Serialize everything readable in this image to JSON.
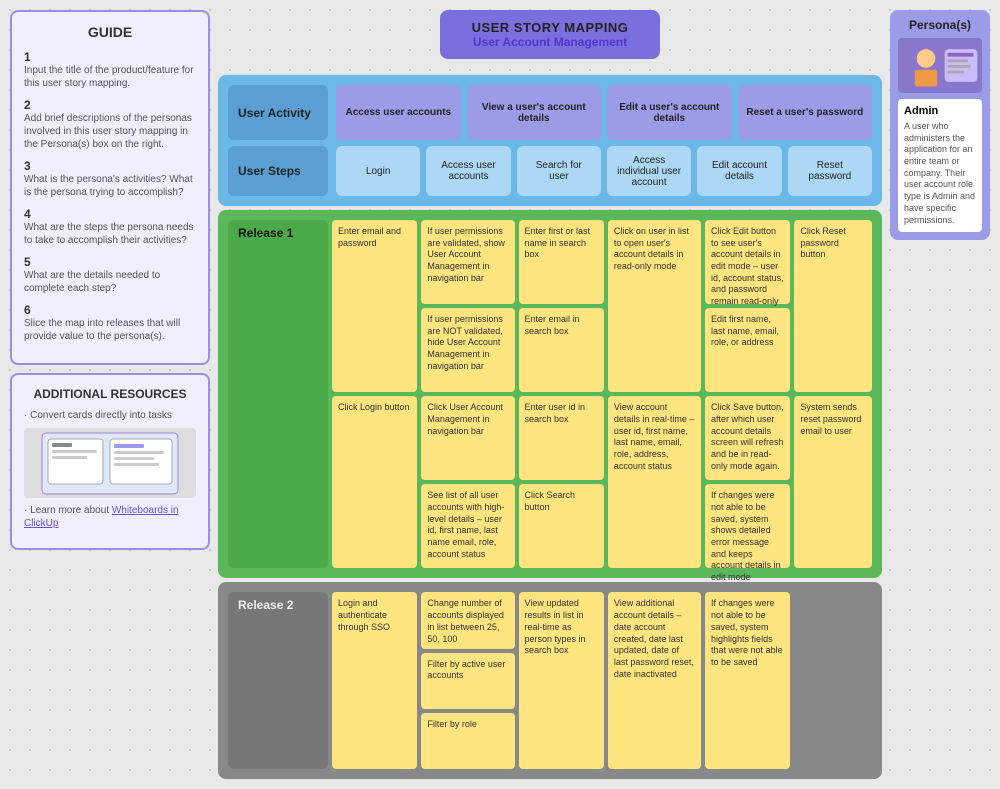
{
  "header": {
    "title": "USER STORY MAPPING",
    "subtitle": "User Account Management"
  },
  "guide": {
    "title": "GUIDE",
    "steps": [
      {
        "num": "1",
        "text": "Input the title of the product/feature for this user story mapping."
      },
      {
        "num": "2",
        "text": "Add brief descriptions of the personas involved in this user story mapping in the Persona(s) box on the right."
      },
      {
        "num": "3",
        "text": "What is the persona's activities? What is the persona trying to accomplish?"
      },
      {
        "num": "4",
        "text": "What are the steps the persona needs to take to accomplish their activities?"
      },
      {
        "num": "5",
        "text": "What are the details needed to complete each step?"
      },
      {
        "num": "6",
        "text": "Slice the map into releases that will provide value to the persona(s)."
      }
    ]
  },
  "resources": {
    "title": "ADDITIONAL RESOURCES",
    "items": [
      "· Convert cards directly into tasks",
      "· Learn more about Whiteboards in ClickUp"
    ]
  },
  "activities": [
    {
      "label": "Access user accounts"
    },
    {
      "label": "View a user's account details"
    },
    {
      "label": "Edit a user's account details"
    },
    {
      "label": "Reset a user's password"
    }
  ],
  "steps": [
    {
      "label": "Login"
    },
    {
      "label": "Access user accounts"
    },
    {
      "label": "Search for user"
    },
    {
      "label": "Access individual user account"
    },
    {
      "label": "Edit account details"
    },
    {
      "label": "Reset password"
    }
  ],
  "row_labels": {
    "user_activity": "User Activity",
    "user_steps": "User Steps",
    "release1": "Release 1",
    "release2": "Release 2"
  },
  "release1_stickies": {
    "col1": [
      "Enter email and password",
      "Click Login button"
    ],
    "col2": [
      "If user permissions are validated, show User Account Management in navigation bar",
      "If user permissions are NOT validated, hide User Account Management in navigation bar",
      "Click User Account Management in navigation bar",
      "See list of all user accounts with high-level details – user id, first name, last name email, role, account status"
    ],
    "col3": [
      "Enter first or last name in search box",
      "Enter email in search box",
      "Enter user id in search box",
      "Click Search button"
    ],
    "col4": [
      "Click on user in list to open user's account details in read-only mode",
      "View account details in real-time – user id, first name, last name, email, role, address, account status"
    ],
    "col5": [
      "Click Edit button to see user's account details in edit mode – user id, account status, and password remain read-only",
      "Edit first name, last name, email, role, or address",
      "Click Save button, after which user account details screen will refresh and be in read-only mode again.",
      "If changes were not able to be saved, system shows detailed error message and keeps account details in edit mode"
    ],
    "col6": [
      "Click Reset password button",
      "System sends reset password email to user"
    ]
  },
  "release2_stickies": {
    "col1": [
      "Login and authenticate through SSO"
    ],
    "col2": [
      "Change number of accounts displayed in list between 25, 50, 100",
      "Filter by active user accounts",
      "Filter by role"
    ],
    "col3": [
      "View updated results in list in real-time as person types in search box"
    ],
    "col4": [
      "View additional account details – date account created, date last updated, date of last password reset, date inactivated"
    ],
    "col5": [
      "If changes were not able to be saved, system highlights fields that were not able to be saved"
    ],
    "col6": []
  },
  "persona": {
    "title": "Persona(s)",
    "name": "Admin",
    "description": "A user who administers the application for an entire team or company. Their user account role type is Admin and have specific permissions."
  }
}
